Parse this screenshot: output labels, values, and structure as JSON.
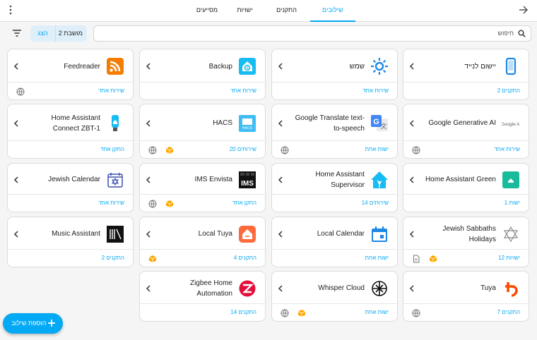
{
  "header": {
    "tabs": [
      {
        "label": "שילובים",
        "active": true
      },
      {
        "label": "התקנים",
        "active": false
      },
      {
        "label": "ישויות",
        "active": false
      },
      {
        "label": "מסייעים",
        "active": false
      }
    ]
  },
  "toolbar": {
    "hide_label": "הצג",
    "group_label": "2 מושבת",
    "search_placeholder": "חיפוש"
  },
  "cards": [
    {
      "title": "יישום לנייד",
      "count": "2 התקנים",
      "logo": "mobile-app-icon",
      "badges": []
    },
    {
      "title": "שמש",
      "count": "שירות אחד",
      "logo": "sun-icon",
      "badges": []
    },
    {
      "title": "Backup",
      "count": "שירות אחד",
      "logo": "backup-icon",
      "badges": []
    },
    {
      "title": "Feedreader",
      "count": "שירות אחד",
      "logo": "rss-icon",
      "badges": [
        "globe-icon"
      ]
    },
    {
      "title": "Google Generative AI",
      "count": "שירות אחד",
      "logo": "google-ai-icon",
      "logo_text": "Google AI",
      "badges": [
        "globe-icon"
      ]
    },
    {
      "title": "Google Translate text-to-speech",
      "count": "ישות אחת",
      "logo": "google-translate-icon",
      "badges": [
        "globe-icon"
      ]
    },
    {
      "title": "HACS",
      "count": "20 שירותים",
      "logo": "hacs-icon",
      "logo_text": "HACS",
      "badges": [
        "globe-icon",
        "custom-package-icon"
      ]
    },
    {
      "title": "Home Assistant Connect ZBT-1",
      "count": "התקן אחד",
      "logo": "zbt1-icon",
      "badges": []
    },
    {
      "title": "Home Assistant Green",
      "count": "1 ישות",
      "logo": "ha-green-icon",
      "badges": []
    },
    {
      "title": "Home Assistant Supervisor",
      "count": "14 שירותים",
      "logo": "home-assistant-icon",
      "badges": []
    },
    {
      "title": "IMS Envista",
      "count": "התקן אחד",
      "logo": "ims-icon",
      "logo_text": "IMS",
      "badges": [
        "globe-icon",
        "custom-package-icon"
      ]
    },
    {
      "title": "Jewish Calendar",
      "count": "שירות אחד",
      "logo": "jewish-calendar-icon",
      "badges": []
    },
    {
      "title": "Jewish Sabbaths Holidays",
      "count": "12 ישויות",
      "logo": "star-of-david-icon",
      "badges": [
        "document-icon",
        "custom-package-icon"
      ]
    },
    {
      "title": "Local Calendar",
      "count": "ישות אחת",
      "logo": "calendar-icon",
      "badges": []
    },
    {
      "title": "Local Tuya",
      "count": "4 התקנים",
      "logo": "local-tuya-icon",
      "badges": [
        "custom-package-icon"
      ]
    },
    {
      "title": "Music Assistant",
      "count": "2 התקנים",
      "logo": "music-assistant-icon",
      "badges": []
    },
    {
      "title": "Tuya",
      "count": "7 התקנים",
      "logo": "tuya-icon",
      "badges": [
        "globe-icon"
      ]
    },
    {
      "title": "Whisper Cloud",
      "count": "ישות אחת",
      "logo": "openai-icon",
      "badges": [
        "globe-icon",
        "custom-package-icon"
      ]
    },
    {
      "title": "Zigbee Home Automation",
      "count": "14 התקנים",
      "logo": "zigbee-icon",
      "badges": []
    }
  ],
  "fab": {
    "label": "הוספת שילוב"
  },
  "colors": {
    "accent": "#03a9f4",
    "custom_badge": "#ffa600",
    "tuya": "#ff4800",
    "zigbee": "#e10f3c",
    "hacs": "#41bdf5"
  }
}
